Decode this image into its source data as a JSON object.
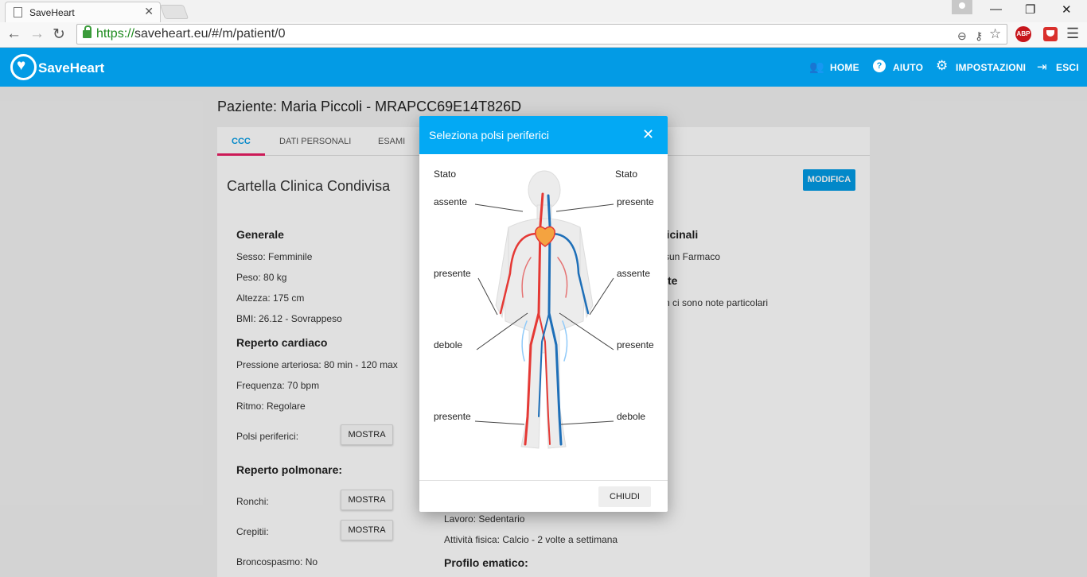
{
  "browser": {
    "tab_title": "SaveHeart",
    "url_scheme": "https://",
    "url_rest": "saveheart.eu/#/m/patient/0",
    "abp_label": "ABP"
  },
  "appbar": {
    "brand": "SaveHeart",
    "nav": [
      "HOME",
      "AIUTO",
      "IMPOSTAZIONI",
      "ESCI"
    ],
    "color": "#039be5"
  },
  "page": {
    "title": "Paziente: Maria Piccoli - MRAPCC69E14T826D",
    "tabs": [
      "CCC",
      "DATI PERSONALI",
      "ESAMI"
    ],
    "card_title": "Cartella Clinica Condivisa",
    "edit_label": "MODIFICA",
    "generale": {
      "heading": "Generale",
      "lines": [
        "Sesso: Femminile",
        "Peso: 80 kg",
        "Altezza: 175 cm",
        "BMI: 26.12 - Sovrappeso"
      ]
    },
    "cardiaco": {
      "heading": "Reperto cardiaco",
      "lines": [
        "Pressione arteriosa: 80 min - 120 max",
        "Frequenza: 70 bpm",
        "Ritmo: Regolare"
      ],
      "polsi_label": "Polsi periferici:"
    },
    "polmonare": {
      "heading": "Reperto polmonare:",
      "ronchi": "Ronchi:",
      "crepitii": "Crepitii:",
      "broncospasmo": "Broncospasmo: No"
    },
    "show_label": "MOSTRA",
    "right_col": {
      "medicinali_heading": "dicinali",
      "farmaco": "ssun Farmaco",
      "note_heading": "te",
      "note": "n ci sono note particolari",
      "lavoro": "Lavoro: Sedentario",
      "attivita": "Attività fisica: Calcio - 2 volte a settimana",
      "profilo_heading": "Profilo ematico:"
    }
  },
  "modal": {
    "title": "Seleziona polsi periferici",
    "close_label": "CHIUDI",
    "stato_left": "Stato",
    "stato_right": "Stato",
    "left_labels": [
      "assente",
      "presente",
      "debole",
      "presente"
    ],
    "right_labels": [
      "presente",
      "assente",
      "presente",
      "debole"
    ],
    "colors": {
      "artery": "#e53935",
      "vein": "#1e6fb8",
      "header": "#03a9f4"
    }
  }
}
